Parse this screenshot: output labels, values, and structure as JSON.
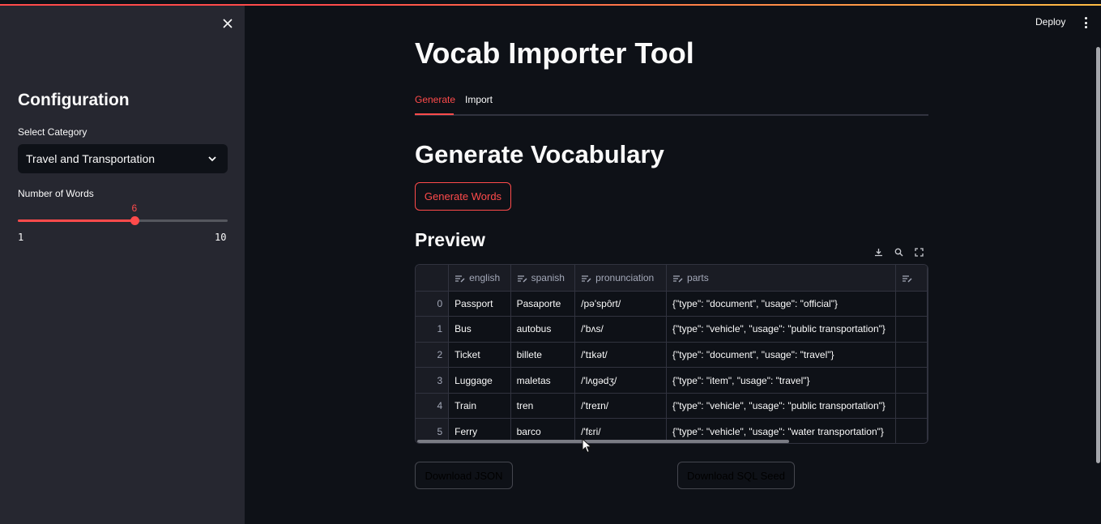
{
  "header": {
    "deploy_label": "Deploy"
  },
  "sidebar": {
    "title": "Configuration",
    "category_label": "Select Category",
    "category_value": "Travel and Transportation",
    "words_label": "Number of Words",
    "slider": {
      "value": "6",
      "min": "1",
      "max": "10",
      "fraction": 0.5556
    }
  },
  "main": {
    "title": "Vocab Importer Tool",
    "tabs": [
      {
        "label": "Generate"
      },
      {
        "label": "Import"
      }
    ],
    "section_title": "Generate Vocabulary",
    "generate_button": "Generate Words",
    "preview_title": "Preview",
    "download_json": "Download JSON",
    "download_sql": "Download SQL Seed"
  },
  "table": {
    "columns": [
      "english",
      "spanish",
      "pronunciation",
      "parts"
    ],
    "rows": [
      {
        "idx": "0",
        "english": "Passport",
        "spanish": "Pasaporte",
        "pronunciation": "/pə'spôrt/",
        "parts": "{\"type\": \"document\", \"usage\": \"official\"}"
      },
      {
        "idx": "1",
        "english": "Bus",
        "spanish": "autobus",
        "pronunciation": "/'bʌs/",
        "parts": "{\"type\": \"vehicle\", \"usage\": \"public transportation\"}"
      },
      {
        "idx": "2",
        "english": "Ticket",
        "spanish": "billete",
        "pronunciation": "/'tɪkət/",
        "parts": "{\"type\": \"document\", \"usage\": \"travel\"}"
      },
      {
        "idx": "3",
        "english": "Luggage",
        "spanish": "maletas",
        "pronunciation": "/'lʌgədʒ/",
        "parts": "{\"type\": \"item\", \"usage\": \"travel\"}"
      },
      {
        "idx": "4",
        "english": "Train",
        "spanish": "tren",
        "pronunciation": "/'treɪn/",
        "parts": "{\"type\": \"vehicle\", \"usage\": \"public transportation\"}"
      },
      {
        "idx": "5",
        "english": "Ferry",
        "spanish": "barco",
        "pronunciation": "/'fɛri/",
        "parts": "{\"type\": \"vehicle\", \"usage\": \"water transportation\"}"
      }
    ]
  },
  "colors": {
    "accent": "#ff4b4b",
    "background": "#0e1117",
    "sidebar": "#262730"
  }
}
